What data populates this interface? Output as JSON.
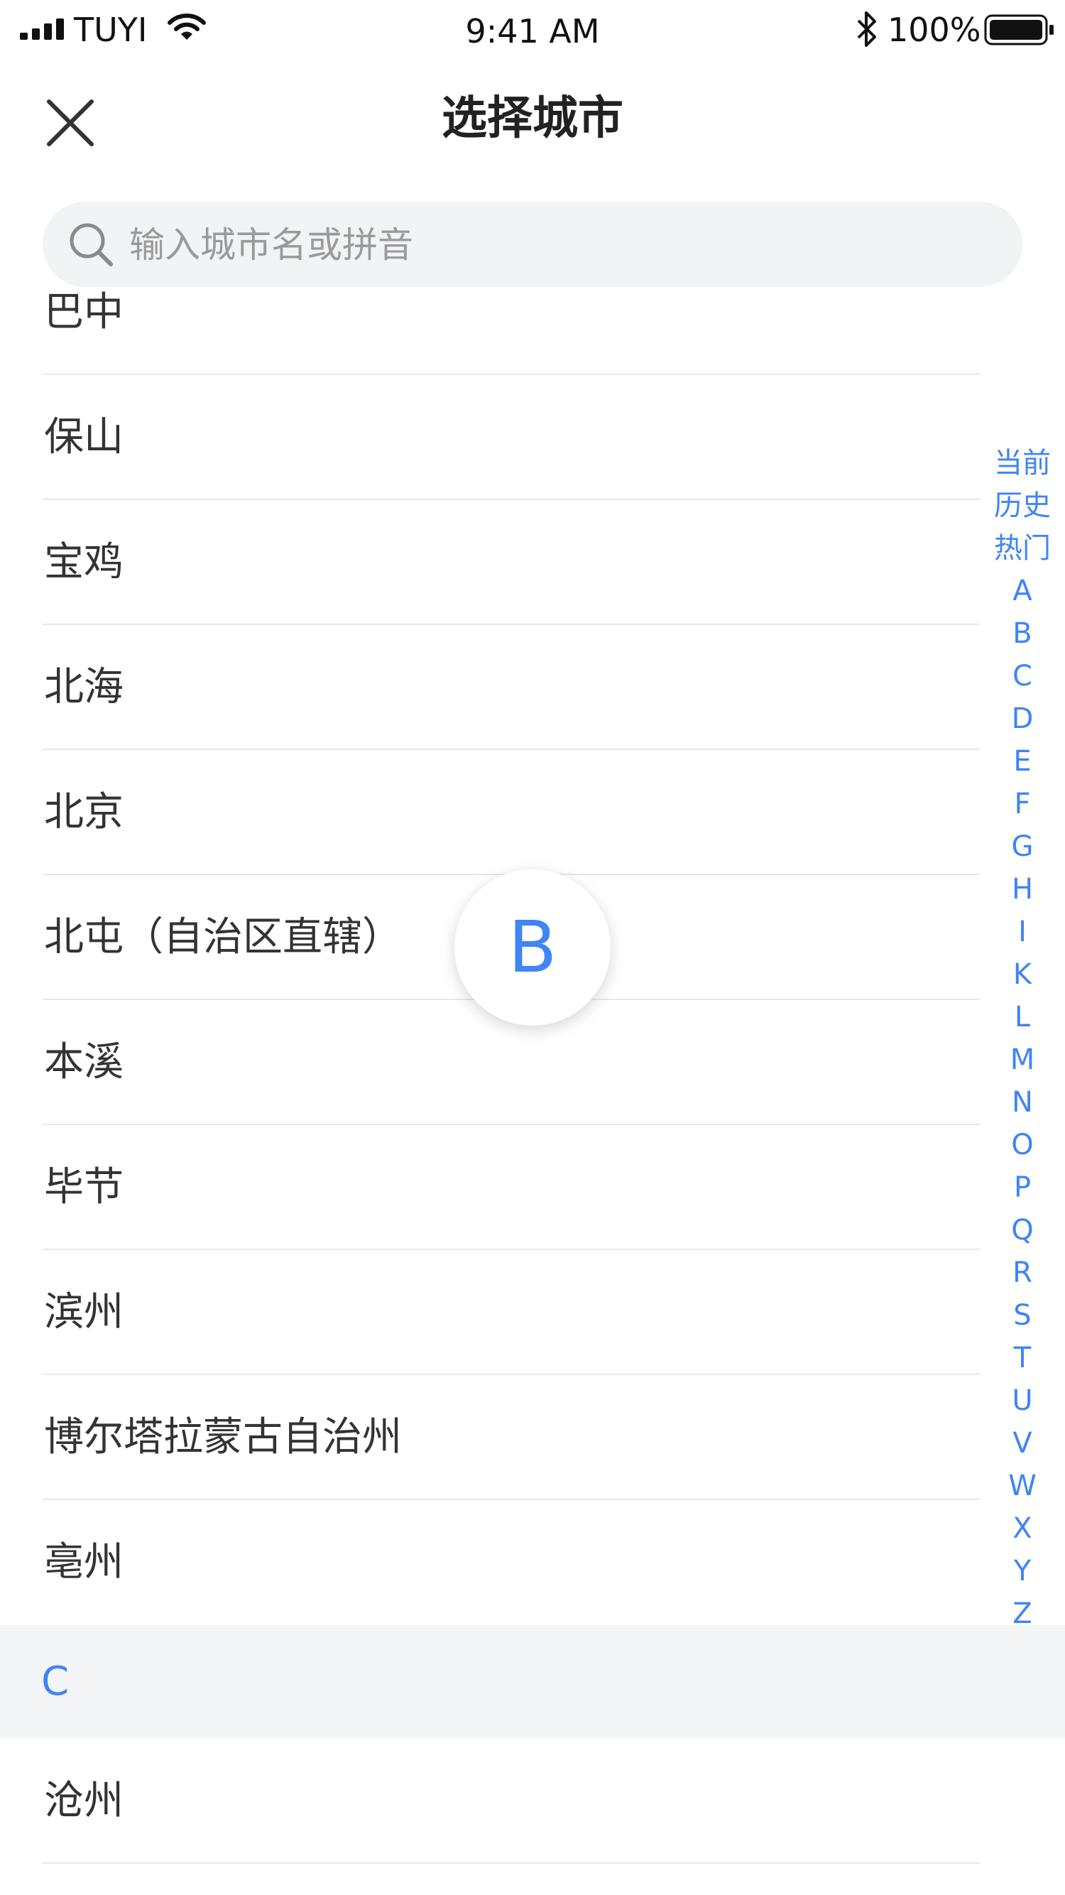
{
  "status_bar": {
    "carrier": "TUYI",
    "time": "9:41 AM",
    "battery_percent": "100%",
    "icons": [
      "signal-icon",
      "wifi-icon",
      "bluetooth-icon",
      "battery-icon"
    ]
  },
  "nav": {
    "title": "选择城市",
    "close_icon": "close-icon"
  },
  "search": {
    "placeholder": "输入城市名或拼音",
    "value": "",
    "icon": "search-icon"
  },
  "city_list": {
    "partial_top": "巴中",
    "section_b": [
      "保山",
      "宝鸡",
      "北海",
      "北京",
      "北屯（自治区直辖）",
      "本溪",
      "毕节",
      "滨州",
      "博尔塔拉蒙古自治州",
      "亳州"
    ],
    "section_c_header": "C",
    "section_c": [
      "沧州"
    ]
  },
  "index_bar": [
    "当前",
    "历史",
    "热门",
    "A",
    "B",
    "C",
    "D",
    "E",
    "F",
    "G",
    "H",
    "I",
    "K",
    "L",
    "M",
    "N",
    "O",
    "P",
    "Q",
    "R",
    "S",
    "T",
    "U",
    "V",
    "W",
    "X",
    "Y",
    "Z"
  ],
  "letter_indicator": "B",
  "colors": {
    "accent": "#3f85f4",
    "text": "#333333",
    "divider": "#e8e8e8",
    "section_bg": "#f4f5f7",
    "search_bg": "#f2f3f5"
  }
}
